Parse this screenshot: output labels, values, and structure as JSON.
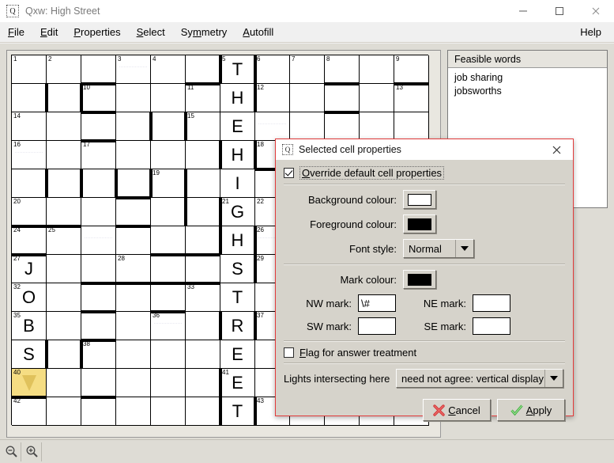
{
  "window": {
    "title": "Qxw: High Street",
    "icon": "app-icon-q",
    "minimize": "minimize-icon",
    "maximize": "maximize-icon",
    "close": "close-icon"
  },
  "menubar": {
    "items": [
      {
        "label": "File",
        "accel": "F"
      },
      {
        "label": "Edit",
        "accel": "E"
      },
      {
        "label": "Properties",
        "accel": "P"
      },
      {
        "label": "Select",
        "accel": "S"
      },
      {
        "label": "Symmetry",
        "accel": "m"
      },
      {
        "label": "Autofill",
        "accel": "A"
      }
    ],
    "help": "Help"
  },
  "feasible_words": {
    "header": "Feasible words",
    "items": [
      "job sharing",
      "jobsworths"
    ]
  },
  "toolbar": {
    "zoom_out": "zoom-out-icon",
    "zoom_in": "zoom-in-icon"
  },
  "grid": {
    "cols": 12,
    "rows": 13,
    "cells": [
      {
        "r": 0,
        "c": 0,
        "num": "1"
      },
      {
        "r": 0,
        "c": 1,
        "num": "2"
      },
      {
        "r": 0,
        "c": 2,
        "num": ""
      },
      {
        "r": 0,
        "c": 3,
        "num": "3",
        "dots": true
      },
      {
        "r": 0,
        "c": 4,
        "num": "4"
      },
      {
        "r": 0,
        "c": 5,
        "num": ""
      },
      {
        "r": 0,
        "c": 6,
        "num": "5",
        "letter": "T"
      },
      {
        "r": 0,
        "c": 7,
        "num": "6"
      },
      {
        "r": 0,
        "c": 8,
        "num": "7"
      },
      {
        "r": 0,
        "c": 9,
        "num": "8"
      },
      {
        "r": 0,
        "c": 10,
        "num": ""
      },
      {
        "r": 0,
        "c": 11,
        "num": "9"
      },
      {
        "r": 1,
        "c": 0,
        "num": ""
      },
      {
        "r": 1,
        "c": 1,
        "num": ""
      },
      {
        "r": 1,
        "c": 2,
        "num": "10"
      },
      {
        "r": 1,
        "c": 3,
        "num": ""
      },
      {
        "r": 1,
        "c": 4,
        "num": ""
      },
      {
        "r": 1,
        "c": 5,
        "num": "11"
      },
      {
        "r": 1,
        "c": 6,
        "num": "",
        "letter": "H"
      },
      {
        "r": 1,
        "c": 7,
        "num": "12"
      },
      {
        "r": 1,
        "c": 8,
        "num": ""
      },
      {
        "r": 1,
        "c": 9,
        "num": ""
      },
      {
        "r": 1,
        "c": 10,
        "num": ""
      },
      {
        "r": 1,
        "c": 11,
        "num": "13"
      },
      {
        "r": 2,
        "c": 0,
        "num": "14"
      },
      {
        "r": 2,
        "c": 1,
        "num": ""
      },
      {
        "r": 2,
        "c": 2,
        "num": ""
      },
      {
        "r": 2,
        "c": 3,
        "num": ""
      },
      {
        "r": 2,
        "c": 4,
        "num": ""
      },
      {
        "r": 2,
        "c": 5,
        "num": "15"
      },
      {
        "r": 2,
        "c": 6,
        "num": "",
        "letter": "E"
      },
      {
        "r": 2,
        "c": 7,
        "num": "",
        "dots": true
      },
      {
        "r": 2,
        "c": 8,
        "num": ""
      },
      {
        "r": 2,
        "c": 9,
        "num": ""
      },
      {
        "r": 2,
        "c": 10,
        "num": ""
      },
      {
        "r": 2,
        "c": 11,
        "num": ""
      },
      {
        "r": 3,
        "c": 0,
        "num": "16",
        "dots": true
      },
      {
        "r": 3,
        "c": 1,
        "num": ""
      },
      {
        "r": 3,
        "c": 2,
        "num": "17"
      },
      {
        "r": 3,
        "c": 3,
        "num": ""
      },
      {
        "r": 3,
        "c": 4,
        "num": ""
      },
      {
        "r": 3,
        "c": 5,
        "num": ""
      },
      {
        "r": 3,
        "c": 6,
        "num": "",
        "letter": "H"
      },
      {
        "r": 3,
        "c": 7,
        "num": "18"
      },
      {
        "r": 3,
        "c": 8,
        "num": ""
      },
      {
        "r": 3,
        "c": 9,
        "num": ""
      },
      {
        "r": 3,
        "c": 10,
        "num": ""
      },
      {
        "r": 3,
        "c": 11,
        "num": ""
      },
      {
        "r": 4,
        "c": 0,
        "num": ""
      },
      {
        "r": 4,
        "c": 1,
        "num": ""
      },
      {
        "r": 4,
        "c": 2,
        "num": ""
      },
      {
        "r": 4,
        "c": 3,
        "num": ""
      },
      {
        "r": 4,
        "c": 4,
        "num": "19"
      },
      {
        "r": 4,
        "c": 5,
        "num": ""
      },
      {
        "r": 4,
        "c": 6,
        "num": "",
        "letter": "I"
      },
      {
        "r": 4,
        "c": 7,
        "num": ""
      },
      {
        "r": 4,
        "c": 8,
        "num": ""
      },
      {
        "r": 4,
        "c": 9,
        "num": ""
      },
      {
        "r": 4,
        "c": 10,
        "num": ""
      },
      {
        "r": 4,
        "c": 11,
        "num": ""
      },
      {
        "r": 5,
        "c": 0,
        "num": "20"
      },
      {
        "r": 5,
        "c": 1,
        "num": ""
      },
      {
        "r": 5,
        "c": 2,
        "num": ""
      },
      {
        "r": 5,
        "c": 3,
        "num": ""
      },
      {
        "r": 5,
        "c": 4,
        "num": ""
      },
      {
        "r": 5,
        "c": 5,
        "num": ""
      },
      {
        "r": 5,
        "c": 6,
        "num": "21",
        "letter": "G"
      },
      {
        "r": 5,
        "c": 7,
        "num": "22"
      },
      {
        "r": 5,
        "c": 8,
        "num": ""
      },
      {
        "r": 5,
        "c": 9,
        "num": ""
      },
      {
        "r": 5,
        "c": 10,
        "num": ""
      },
      {
        "r": 5,
        "c": 11,
        "num": ""
      },
      {
        "r": 6,
        "c": 0,
        "num": "24"
      },
      {
        "r": 6,
        "c": 1,
        "num": "25"
      },
      {
        "r": 6,
        "c": 2,
        "num": "",
        "dots": true
      },
      {
        "r": 6,
        "c": 3,
        "num": ""
      },
      {
        "r": 6,
        "c": 4,
        "num": ""
      },
      {
        "r": 6,
        "c": 5,
        "num": ""
      },
      {
        "r": 6,
        "c": 6,
        "num": "",
        "letter": "H"
      },
      {
        "r": 6,
        "c": 7,
        "num": "26",
        "dots": true
      },
      {
        "r": 6,
        "c": 8,
        "num": ""
      },
      {
        "r": 6,
        "c": 9,
        "num": ""
      },
      {
        "r": 6,
        "c": 10,
        "num": ""
      },
      {
        "r": 6,
        "c": 11,
        "num": ""
      },
      {
        "r": 7,
        "c": 0,
        "num": "27",
        "letter": "J"
      },
      {
        "r": 7,
        "c": 1,
        "num": ""
      },
      {
        "r": 7,
        "c": 2,
        "num": ""
      },
      {
        "r": 7,
        "c": 3,
        "num": "28"
      },
      {
        "r": 7,
        "c": 4,
        "num": ""
      },
      {
        "r": 7,
        "c": 5,
        "num": ""
      },
      {
        "r": 7,
        "c": 6,
        "num": "",
        "letter": "S"
      },
      {
        "r": 7,
        "c": 7,
        "num": "29"
      },
      {
        "r": 7,
        "c": 8,
        "num": ""
      },
      {
        "r": 7,
        "c": 9,
        "num": ""
      },
      {
        "r": 7,
        "c": 10,
        "num": ""
      },
      {
        "r": 7,
        "c": 11,
        "num": ""
      },
      {
        "r": 8,
        "c": 0,
        "num": "32",
        "letter": "O"
      },
      {
        "r": 8,
        "c": 1,
        "num": ""
      },
      {
        "r": 8,
        "c": 2,
        "num": ""
      },
      {
        "r": 8,
        "c": 3,
        "num": ""
      },
      {
        "r": 8,
        "c": 4,
        "num": ""
      },
      {
        "r": 8,
        "c": 5,
        "num": "33"
      },
      {
        "r": 8,
        "c": 6,
        "num": "",
        "letter": "T"
      },
      {
        "r": 8,
        "c": 7,
        "num": ""
      },
      {
        "r": 8,
        "c": 8,
        "num": ""
      },
      {
        "r": 8,
        "c": 9,
        "num": ""
      },
      {
        "r": 8,
        "c": 10,
        "num": ""
      },
      {
        "r": 8,
        "c": 11,
        "num": ""
      },
      {
        "r": 9,
        "c": 0,
        "num": "35",
        "letter": "B"
      },
      {
        "r": 9,
        "c": 1,
        "num": ""
      },
      {
        "r": 9,
        "c": 2,
        "num": ""
      },
      {
        "r": 9,
        "c": 3,
        "num": ""
      },
      {
        "r": 9,
        "c": 4,
        "num": "36",
        "dots": true
      },
      {
        "r": 9,
        "c": 5,
        "num": ""
      },
      {
        "r": 9,
        "c": 6,
        "num": "",
        "letter": "R"
      },
      {
        "r": 9,
        "c": 7,
        "num": "37"
      },
      {
        "r": 9,
        "c": 8,
        "num": ""
      },
      {
        "r": 9,
        "c": 9,
        "num": ""
      },
      {
        "r": 9,
        "c": 10,
        "num": ""
      },
      {
        "r": 9,
        "c": 11,
        "num": ""
      },
      {
        "r": 10,
        "c": 0,
        "num": "",
        "letter": "S"
      },
      {
        "r": 10,
        "c": 1,
        "num": ""
      },
      {
        "r": 10,
        "c": 2,
        "num": "38"
      },
      {
        "r": 10,
        "c": 3,
        "num": ""
      },
      {
        "r": 10,
        "c": 4,
        "num": ""
      },
      {
        "r": 10,
        "c": 5,
        "num": ""
      },
      {
        "r": 10,
        "c": 6,
        "num": "",
        "letter": "E"
      },
      {
        "r": 10,
        "c": 7,
        "num": ""
      },
      {
        "r": 10,
        "c": 8,
        "num": ""
      },
      {
        "r": 10,
        "c": 9,
        "num": ""
      },
      {
        "r": 10,
        "c": 10,
        "num": ""
      },
      {
        "r": 10,
        "c": 11,
        "num": ""
      },
      {
        "r": 11,
        "c": 0,
        "num": "40",
        "selected": true,
        "arrow": true
      },
      {
        "r": 11,
        "c": 1,
        "num": ""
      },
      {
        "r": 11,
        "c": 2,
        "num": ""
      },
      {
        "r": 11,
        "c": 3,
        "num": ""
      },
      {
        "r": 11,
        "c": 4,
        "num": ""
      },
      {
        "r": 11,
        "c": 5,
        "num": ""
      },
      {
        "r": 11,
        "c": 6,
        "num": "41",
        "letter": "E"
      },
      {
        "r": 11,
        "c": 7,
        "num": ""
      },
      {
        "r": 11,
        "c": 8,
        "num": ""
      },
      {
        "r": 11,
        "c": 9,
        "num": ""
      },
      {
        "r": 11,
        "c": 10,
        "num": ""
      },
      {
        "r": 11,
        "c": 11,
        "num": ""
      },
      {
        "r": 12,
        "c": 0,
        "num": "42"
      },
      {
        "r": 12,
        "c": 1,
        "num": ""
      },
      {
        "r": 12,
        "c": 2,
        "num": ""
      },
      {
        "r": 12,
        "c": 3,
        "num": ""
      },
      {
        "r": 12,
        "c": 4,
        "num": ""
      },
      {
        "r": 12,
        "c": 5,
        "num": ""
      },
      {
        "r": 12,
        "c": 6,
        "num": "",
        "letter": "T"
      },
      {
        "r": 12,
        "c": 7,
        "num": "43"
      },
      {
        "r": 12,
        "c": 8,
        "num": ""
      },
      {
        "r": 12,
        "c": 9,
        "num": ""
      },
      {
        "r": 12,
        "c": 10,
        "num": ""
      },
      {
        "r": 12,
        "c": 11,
        "num": ""
      }
    ],
    "bars_top": [
      {
        "r": 1,
        "c": 2
      },
      {
        "r": 1,
        "c": 5
      },
      {
        "r": 1,
        "c": 9
      },
      {
        "r": 1,
        "c": 11
      },
      {
        "r": 2,
        "c": 2
      },
      {
        "r": 2,
        "c": 9
      },
      {
        "r": 3,
        "c": 2
      },
      {
        "r": 4,
        "c": 7
      },
      {
        "r": 5,
        "c": 3
      },
      {
        "r": 5,
        "c": 8
      },
      {
        "r": 6,
        "c": 0
      },
      {
        "r": 6,
        "c": 1
      },
      {
        "r": 6,
        "c": 3
      },
      {
        "r": 7,
        "c": 0
      },
      {
        "r": 7,
        "c": 4
      },
      {
        "r": 7,
        "c": 5
      },
      {
        "r": 8,
        "c": 2
      },
      {
        "r": 8,
        "c": 3
      },
      {
        "r": 8,
        "c": 4
      },
      {
        "r": 8,
        "c": 5
      },
      {
        "r": 9,
        "c": 2
      },
      {
        "r": 9,
        "c": 4
      },
      {
        "r": 10,
        "c": 2
      },
      {
        "r": 12,
        "c": 0
      },
      {
        "r": 12,
        "c": 2
      }
    ],
    "bars_left": [
      {
        "r": 0,
        "c": 6
      },
      {
        "r": 0,
        "c": 7
      },
      {
        "r": 1,
        "c": 1
      },
      {
        "r": 1,
        "c": 2
      },
      {
        "r": 1,
        "c": 7
      },
      {
        "r": 2,
        "c": 4
      },
      {
        "r": 2,
        "c": 5
      },
      {
        "r": 3,
        "c": 6
      },
      {
        "r": 3,
        "c": 7
      },
      {
        "r": 4,
        "c": 1
      },
      {
        "r": 4,
        "c": 2
      },
      {
        "r": 4,
        "c": 3
      },
      {
        "r": 4,
        "c": 4
      },
      {
        "r": 4,
        "c": 5
      },
      {
        "r": 5,
        "c": 5
      },
      {
        "r": 5,
        "c": 6
      },
      {
        "r": 6,
        "c": 6
      },
      {
        "r": 6,
        "c": 7
      },
      {
        "r": 7,
        "c": 7
      },
      {
        "r": 9,
        "c": 6
      },
      {
        "r": 9,
        "c": 7
      },
      {
        "r": 10,
        "c": 1
      },
      {
        "r": 10,
        "c": 2
      },
      {
        "r": 11,
        "c": 6
      },
      {
        "r": 12,
        "c": 6
      },
      {
        "r": 12,
        "c": 7
      }
    ]
  },
  "dialog": {
    "title": "Selected cell properties",
    "icon": "app-icon-q",
    "close": "close-icon",
    "override": {
      "label": "Override default cell properties",
      "accel": "O",
      "checked": true
    },
    "background_colour": {
      "label": "Background colour:",
      "value": "#ffffff"
    },
    "foreground_colour": {
      "label": "Foreground colour:",
      "value": "#000000"
    },
    "font_style": {
      "label": "Font style:",
      "value": "Normal"
    },
    "mark_colour": {
      "label": "Mark colour:",
      "value": "#000000"
    },
    "nw_mark": {
      "label": "NW mark:",
      "value": "\\#"
    },
    "ne_mark": {
      "label": "NE mark:",
      "value": ""
    },
    "sw_mark": {
      "label": "SW mark:",
      "value": ""
    },
    "se_mark": {
      "label": "SE mark:",
      "value": ""
    },
    "flag": {
      "label": "Flag for answer treatment",
      "accel": "F",
      "checked": false
    },
    "lights": {
      "label": "Lights intersecting here",
      "value": "need not agree: vertical display"
    },
    "cancel": {
      "label": "Cancel",
      "accel": "C",
      "icon": "cancel-cross-icon"
    },
    "apply": {
      "label": "Apply",
      "accel": "A",
      "icon": "apply-tick-icon"
    }
  }
}
